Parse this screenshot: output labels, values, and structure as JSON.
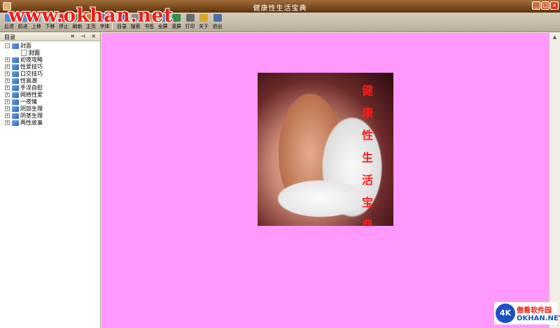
{
  "window": {
    "title": "健康性生活宝典"
  },
  "watermark": "www.okhan.net",
  "toolbar": {
    "nav": [
      {
        "label": "后退",
        "color": "#5c8ccf"
      },
      {
        "label": "前进",
        "color": "#5c8ccf"
      },
      {
        "label": "上移",
        "color": "#5c8ccf"
      },
      {
        "label": "下移",
        "color": "#4caf50"
      },
      {
        "label": "停止",
        "color": "#d9342b"
      },
      {
        "label": "刷新",
        "color": "#3f8f3f"
      },
      {
        "label": "主页",
        "color": "#c08a2e"
      },
      {
        "label": "字体",
        "color": "#7a5a8a"
      }
    ],
    "tools": [
      {
        "label": "目录",
        "color": "#2f62b8"
      },
      {
        "label": "搜索",
        "color": "#8a8a8a"
      },
      {
        "label": "书签",
        "color": "#9d6b3a"
      },
      {
        "label": "全屏",
        "color": "#3a7fc0"
      },
      {
        "label": "滚屏",
        "color": "#2e8f4a"
      },
      {
        "label": "打印",
        "color": "#6b6b6b"
      },
      {
        "label": "关于",
        "color": "#d6a628"
      },
      {
        "label": "退出",
        "color": "#4a6fa8"
      }
    ]
  },
  "panel": {
    "title": "目录",
    "buttons": "¤ ⊣ ×",
    "root": {
      "label": "封面",
      "expander": "−"
    },
    "root_child": {
      "label": "封面"
    },
    "items": [
      {
        "label": "初夜攻略",
        "expander": "+"
      },
      {
        "label": "性爱技巧",
        "expander": "+"
      },
      {
        "label": "口交技巧",
        "expander": "+"
      },
      {
        "label": "性高潮",
        "expander": "+"
      },
      {
        "label": "手淫自慰",
        "expander": "+"
      },
      {
        "label": "网络性爱",
        "expander": "+"
      },
      {
        "label": "一夜情",
        "expander": "+"
      },
      {
        "label": "阴部生理",
        "expander": "+"
      },
      {
        "label": "阴茎生理",
        "expander": "+"
      },
      {
        "label": "两性故事",
        "expander": "+"
      }
    ]
  },
  "cover": {
    "title_chars": [
      "健",
      "康",
      "性",
      "生",
      "活",
      "宝",
      "典"
    ]
  },
  "logo": {
    "mark": "4K",
    "cn": "傲看软件园",
    "en": "OKHAN.NET"
  },
  "colors": {
    "content_bg": "#ff99ff",
    "titlebar": "#7a4a1c",
    "watermark": "#e8201a"
  }
}
